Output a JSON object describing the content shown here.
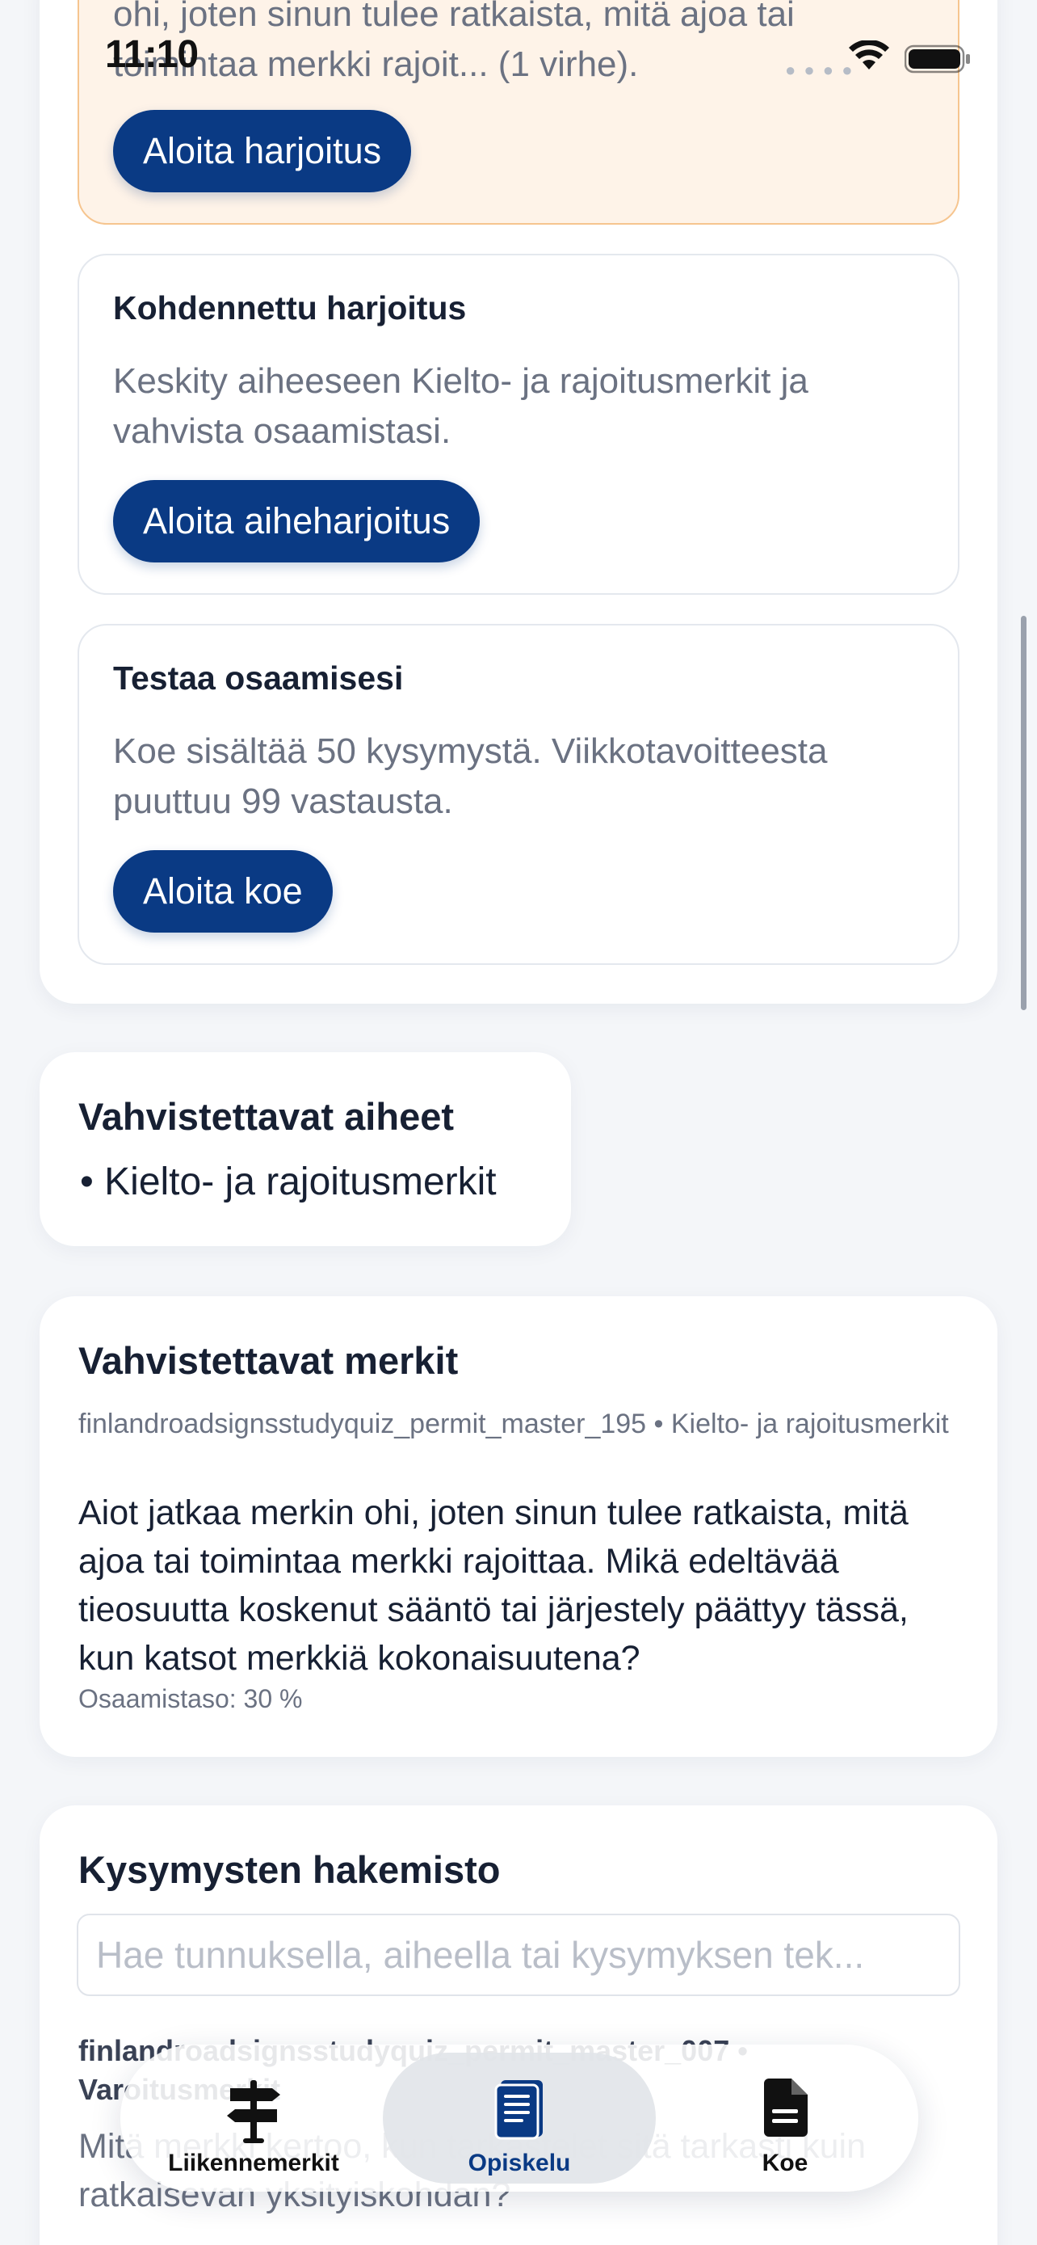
{
  "status_bar": {
    "time": "11:10"
  },
  "practice": {
    "warn_text": "ohi, joten sinun tulee ratkaista, mitä ajoa tai toimintaa merkki rajoit... (1 virhe).",
    "warn_button": "Aloita harjoitus",
    "topic_title": "Kohdennettu harjoitus",
    "topic_desc": "Keskity aiheeseen Kielto- ja rajoitusmerkit ja vahvista osaamistasi.",
    "topic_button": "Aloita aiheharjoitus",
    "test_title": "Testaa osaamisesi",
    "test_desc": "Koe sisältää 50 kysymystä. Viikkotavoitteesta puuttuu 99 vastausta.",
    "test_button": "Aloita koe"
  },
  "topics": {
    "title": "Vahvistettavat aiheet",
    "items": [
      "• Kielto- ja rajoitusmerkit"
    ]
  },
  "signs": {
    "title": "Vahvistettavat merkit",
    "meta": "finlandroadsignsstudyquiz_permit_master_195 • Kielto- ja rajoitusmerkit",
    "question": "Aiot jatkaa merkin ohi, joten sinun tulee ratkaista, mitä ajoa tai toimintaa merkki rajoittaa. Mikä edeltävää tieosuutta koskenut sääntö tai järjestely päättyy tässä, kun katsot merkkiä kokonaisuutena?",
    "level": "Osaamistaso: 30 %"
  },
  "directory": {
    "title": "Kysymysten hakemisto",
    "search_placeholder": "Hae tunnuksella, aiheella tai kysymyksen tek...",
    "first_meta": "finlandroadsignsstudyquiz_permit_master_007 • Varoitusmerkit",
    "first_question": "Mitä merkki kertoo, kun tarkastelet sitä tarkasti kuin ratkaisevan yksityiskohdan?"
  },
  "tabbar": {
    "tabs": [
      {
        "label": "Liikennemerkit",
        "icon": "signpost-icon",
        "active": false
      },
      {
        "label": "Opiskelu",
        "icon": "book-icon",
        "active": true
      },
      {
        "label": "Koe",
        "icon": "document-icon",
        "active": false
      }
    ]
  },
  "colors": {
    "accent": "#0a3a84",
    "warning_bg": "#fef3e8",
    "warning_border": "#f6c58f"
  }
}
